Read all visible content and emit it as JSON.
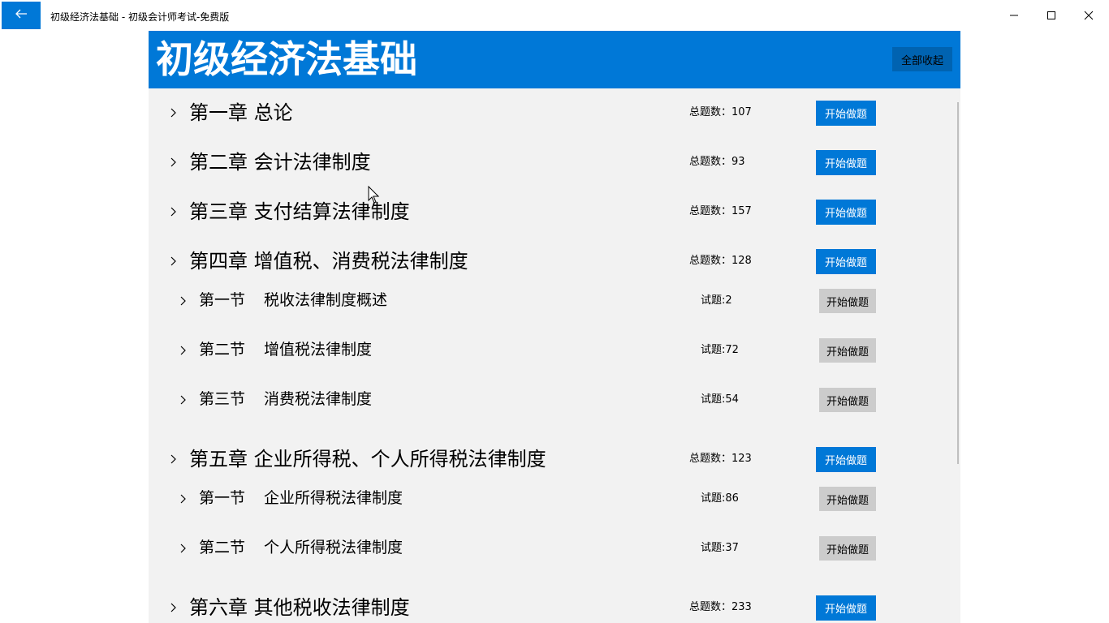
{
  "window": {
    "title": "初级经济法基础 - 初级会计师考试-免费版"
  },
  "header": {
    "title": "初级经济法基础",
    "collapse_all_label": "全部收起"
  },
  "chapters": [
    {
      "title": "第一章 总论",
      "count": "总题数：107",
      "button": "开始做题"
    },
    {
      "title": "第二章 会计法律制度",
      "count": "总题数：93",
      "button": "开始做题"
    },
    {
      "title": "第三章 支付结算法律制度",
      "count": "总题数：157",
      "button": "开始做题"
    },
    {
      "title": "第四章 增值税、消费税法律制度",
      "count": "总题数：128",
      "button": "开始做题",
      "sections": [
        {
          "no": "第一节",
          "name": "税收法律制度概述",
          "count": "试题:2",
          "button": "开始做题"
        },
        {
          "no": "第二节",
          "name": "增值税法律制度",
          "count": "试题:72",
          "button": "开始做题"
        },
        {
          "no": "第三节",
          "name": "消费税法律制度",
          "count": "试题:54",
          "button": "开始做题"
        }
      ]
    },
    {
      "title": "第五章 企业所得税、个人所得税法律制度",
      "count": "总题数：123",
      "button": "开始做题",
      "sections": [
        {
          "no": "第一节",
          "name": "企业所得税法律制度",
          "count": "试题:86",
          "button": "开始做题"
        },
        {
          "no": "第二节",
          "name": "个人所得税法律制度",
          "count": "试题:37",
          "button": "开始做题"
        }
      ]
    },
    {
      "title": "第六章 其他税收法律制度",
      "count": "总题数：233",
      "button": "开始做题"
    }
  ],
  "colors": {
    "accent": "#0078d7",
    "panel_bg": "#f2f2f2",
    "section_button_bg": "#cccccc"
  }
}
